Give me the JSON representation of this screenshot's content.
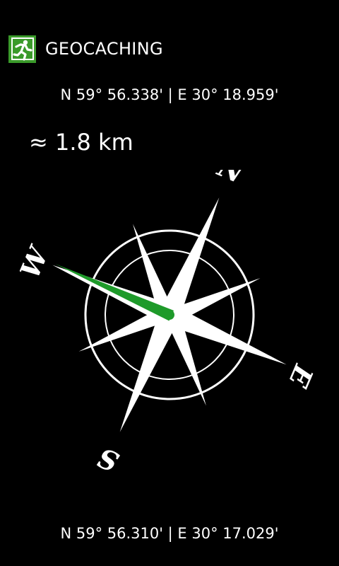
{
  "app": {
    "title": "GEOCACHING",
    "logo_icon": "running-person-icon",
    "accent_color": "#1e9a2a"
  },
  "target_coordinates": "N 59° 56.338' | E 30° 18.959'",
  "distance": "≈ 1.8 km",
  "current_coordinates": "N 59° 56.310' | E 30° 17.029'",
  "compass": {
    "labels": {
      "north": "N",
      "east": "E",
      "south": "S",
      "west": "W"
    },
    "rose_rotation_deg": 23,
    "needle_bearing_deg": 294,
    "needle_color": "#1e9a2a"
  }
}
